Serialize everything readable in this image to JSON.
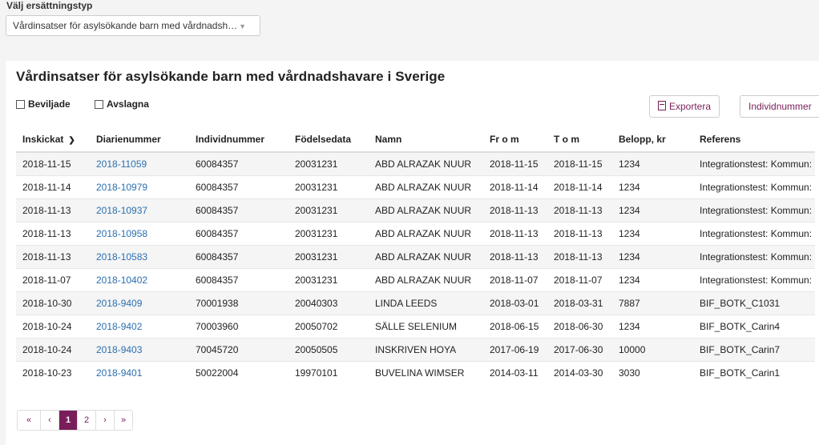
{
  "filter": {
    "label": "Välj ersättningstyp",
    "selected": "Vårdinsatser för asylsökande barn med vårdnadsh…"
  },
  "panel": {
    "title": "Vårdinsatser för asylsökande barn med vårdnadshavare i Sverige",
    "checkbox_approved": "Beviljade",
    "checkbox_rejected": "Avslagna",
    "export_label": "Exportera",
    "individ_label": "Individnummer"
  },
  "table": {
    "headers": [
      "Inskickat",
      "Diarienummer",
      "Individnummer",
      "Födelsedata",
      "Namn",
      "Fr o m",
      "T o m",
      "Belopp, kr",
      "Referens"
    ],
    "rows": [
      [
        "2018-11-15",
        "2018-11059",
        "60084357",
        "20031231",
        "ABD ALRAZAK NUUR",
        "2018-11-15",
        "2018-11-15",
        "1234",
        "Integrationstest: Kommun:"
      ],
      [
        "2018-11-14",
        "2018-10979",
        "60084357",
        "20031231",
        "ABD ALRAZAK NUUR",
        "2018-11-14",
        "2018-11-14",
        "1234",
        "Integrationstest: Kommun:"
      ],
      [
        "2018-11-13",
        "2018-10937",
        "60084357",
        "20031231",
        "ABD ALRAZAK NUUR",
        "2018-11-13",
        "2018-11-13",
        "1234",
        "Integrationstest: Kommun:"
      ],
      [
        "2018-11-13",
        "2018-10958",
        "60084357",
        "20031231",
        "ABD ALRAZAK NUUR",
        "2018-11-13",
        "2018-11-13",
        "1234",
        "Integrationstest: Kommun:"
      ],
      [
        "2018-11-13",
        "2018-10583",
        "60084357",
        "20031231",
        "ABD ALRAZAK NUUR",
        "2018-11-13",
        "2018-11-13",
        "1234",
        "Integrationstest: Kommun:"
      ],
      [
        "2018-11-07",
        "2018-10402",
        "60084357",
        "20031231",
        "ABD ALRAZAK NUUR",
        "2018-11-07",
        "2018-11-07",
        "1234",
        "Integrationstest: Kommun:"
      ],
      [
        "2018-10-30",
        "2018-9409",
        "70001938",
        "20040303",
        "LINDA LEEDS",
        "2018-03-01",
        "2018-03-31",
        "7887",
        "BIF_BOTK_C1031"
      ],
      [
        "2018-10-24",
        "2018-9402",
        "70003960",
        "20050702",
        "SÄLLE SELENIUM",
        "2018-06-15",
        "2018-06-30",
        "1234",
        "BIF_BOTK_Carin4"
      ],
      [
        "2018-10-24",
        "2018-9403",
        "70045720",
        "20050505",
        "INSKRIVEN HOYA",
        "2017-06-19",
        "2017-06-30",
        "10000",
        "BIF_BOTK_Carin7"
      ],
      [
        "2018-10-23",
        "2018-9401",
        "50022004",
        "19970101",
        "BUVELINA WIMSER",
        "2014-03-11",
        "2014-03-30",
        "3030",
        "BIF_BOTK_Carin1"
      ]
    ]
  },
  "pagination": {
    "first": "«",
    "prev": "‹",
    "pages": [
      "1",
      "2"
    ],
    "next": "›",
    "last": "»",
    "current": "1"
  },
  "colors": {
    "accent": "#7a1e5b",
    "link": "#2a6fb0"
  }
}
